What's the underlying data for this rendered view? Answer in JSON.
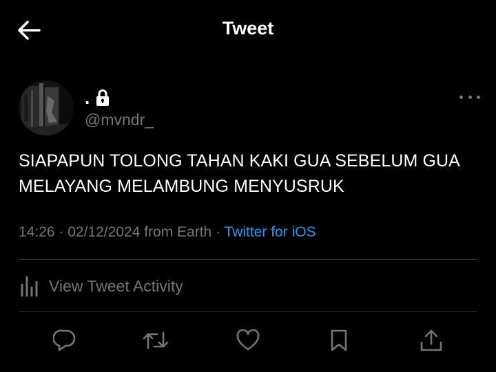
{
  "header": {
    "title": "Tweet",
    "back_icon": "arrow-left-icon"
  },
  "author": {
    "display_name": ".",
    "handle": "@mvndr_",
    "protected_icon": "lock-icon",
    "more_icon": "more-horizontal-icon"
  },
  "tweet": {
    "text": "SIAPAPUN TOLONG TAHAN KAKI GUA SEBELUM GUA MELAYANG MELAMBUNG MENYUSRUK",
    "time": "14:26",
    "date": "02/12/2024",
    "location": "from Earth",
    "separator": "·",
    "source": "Twitter for iOS"
  },
  "activity": {
    "label": "View Tweet Activity",
    "icon": "bar-chart-icon"
  },
  "actions": [
    {
      "icon": "reply-icon"
    },
    {
      "icon": "retweet-icon"
    },
    {
      "icon": "like-heart-icon"
    },
    {
      "icon": "bookmark-icon"
    },
    {
      "icon": "share-icon"
    }
  ],
  "colors": {
    "background": "#000000",
    "primary_text": "#ffffff",
    "secondary_text": "#71767b",
    "link": "#1d9bf0",
    "divider": "#2f3336"
  }
}
